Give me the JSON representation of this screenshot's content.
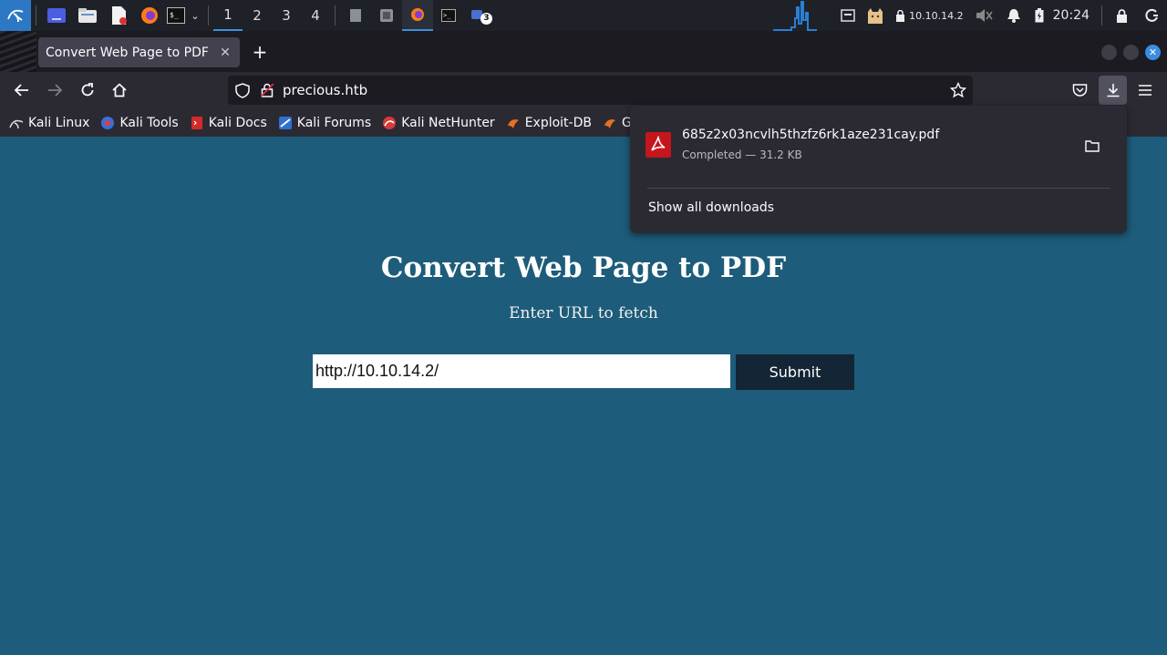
{
  "taskbar": {
    "workspaces": [
      "1",
      "2",
      "3",
      "4"
    ],
    "badge_count": "3",
    "ip_address": "10.10.14.2",
    "clock": "20:24"
  },
  "browser": {
    "tab_title": "Convert Web Page to PDF",
    "url": "precious.htb",
    "bookmarks": [
      "Kali Linux",
      "Kali Tools",
      "Kali Docs",
      "Kali Forums",
      "Kali NetHunter",
      "Exploit-DB",
      "Goog"
    ]
  },
  "downloads": {
    "filename": "685z2x03ncvlh5thzfz6rk1aze231cay.pdf",
    "status": "Completed — 31.2 KB",
    "show_all_label": "Show all downloads"
  },
  "page": {
    "title": "Convert Web Page to PDF",
    "subtitle": "Enter URL to fetch",
    "url_value": "http://10.10.14.2/",
    "submit_label": "Submit"
  },
  "colors": {
    "page_bg": "#1d5c7a",
    "submit_bg": "#142535",
    "accent": "#3a8dde"
  }
}
